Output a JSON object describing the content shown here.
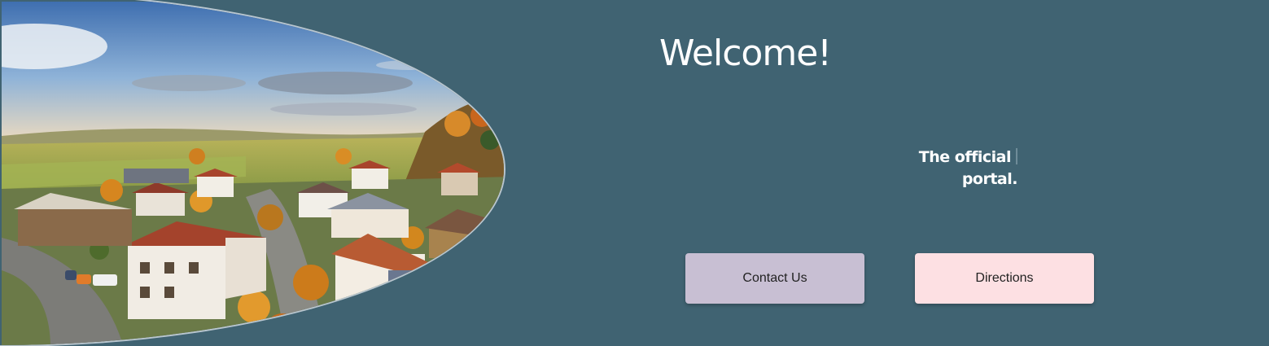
{
  "hero": {
    "title": "Welcome!",
    "subtitle_line1": "The official",
    "subtitle_line2": "portal.",
    "image_alt": "Aerial view of a village with autumn trees and countryside"
  },
  "buttons": {
    "contact_label": "Contact Us",
    "directions_label": "Directions"
  },
  "colors": {
    "background": "#406372",
    "contact_button": "#c8bfd3",
    "directions_button": "#fde0e3",
    "text_light": "#ffffff"
  }
}
